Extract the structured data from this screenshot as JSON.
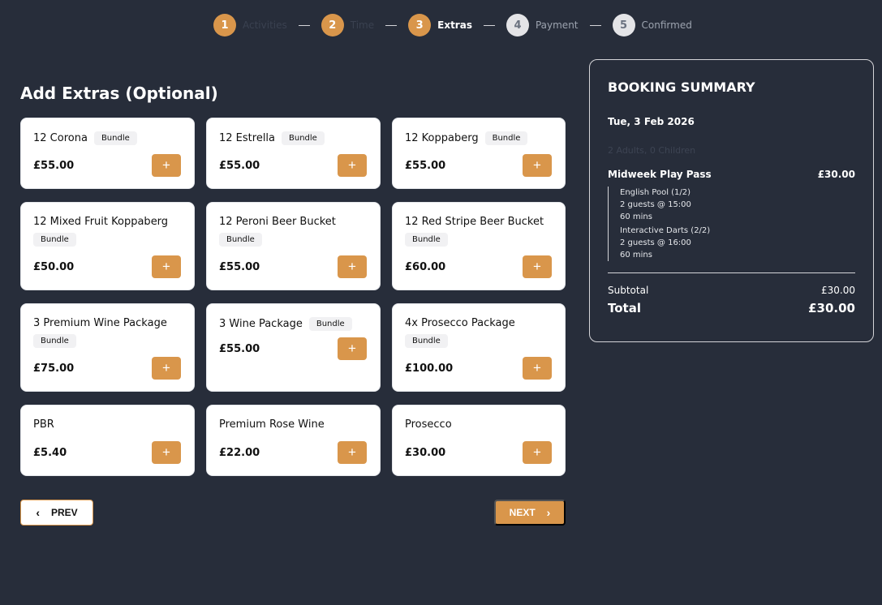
{
  "stepper": {
    "steps": [
      {
        "number": "1",
        "label": "Activities"
      },
      {
        "number": "2",
        "label": "Time"
      },
      {
        "number": "3",
        "label": "Extras"
      },
      {
        "number": "4",
        "label": "Payment"
      },
      {
        "number": "5",
        "label": "Confirmed"
      }
    ]
  },
  "extras": {
    "title": "Add Extras (Optional)",
    "add_label": "+",
    "items": [
      {
        "name": "12 Corona",
        "badge": "Bundle",
        "price": "£55.00"
      },
      {
        "name": "12 Estrella",
        "badge": "Bundle",
        "price": "£55.00"
      },
      {
        "name": "12 Koppaberg",
        "badge": "Bundle",
        "price": "£55.00"
      },
      {
        "name": "12 Mixed Fruit Koppaberg",
        "badge": "Bundle",
        "price": "£50.00"
      },
      {
        "name": "12 Peroni Beer Bucket",
        "badge": "Bundle",
        "price": "£55.00"
      },
      {
        "name": "12 Red Stripe Beer Bucket",
        "badge": "Bundle",
        "price": "£60.00"
      },
      {
        "name": "3 Premium Wine Package",
        "badge": "Bundle",
        "price": "£75.00"
      },
      {
        "name": "3 Wine Package",
        "badge": "Bundle",
        "price": "£55.00"
      },
      {
        "name": "4x Prosecco Package",
        "badge": "Bundle",
        "price": "£100.00"
      },
      {
        "name": "PBR",
        "price": "£5.40"
      },
      {
        "name": "Premium Rose Wine",
        "price": "£22.00"
      },
      {
        "name": "Prosecco",
        "price": "£30.00"
      }
    ]
  },
  "nav": {
    "prev_label": "PREV",
    "next_label": "NEXT"
  },
  "summary": {
    "title": "BOOKING SUMMARY",
    "date": "Tue, 3 Feb 2026",
    "guests": "2 Adults, 0 Children",
    "pass_name": "Midweek Play Pass",
    "pass_price": "£30.00",
    "activities": [
      {
        "name": "English Pool (1/2)",
        "guests": "2 guests @ 15:00",
        "duration": "60 mins"
      },
      {
        "name": "Interactive Darts (2/2)",
        "guests": "2 guests @ 16:00",
        "duration": "60 mins"
      }
    ],
    "subtotal_label": "Subtotal",
    "subtotal_value": "£30.00",
    "total_label": "Total",
    "total_value": "£30.00"
  },
  "colors": {
    "accent": "#d9964b",
    "background": "#272d3a"
  }
}
